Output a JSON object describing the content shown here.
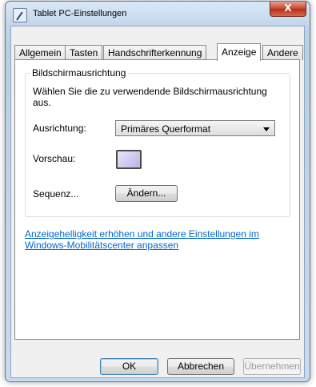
{
  "window": {
    "title": "Tablet PC-Einstellungen",
    "close_label": "X"
  },
  "tabs": [
    {
      "label": "Allgemein",
      "active": false
    },
    {
      "label": "Tasten",
      "active": false
    },
    {
      "label": "Handschrifterkennung",
      "active": false
    },
    {
      "label": "Anzeige",
      "active": true
    },
    {
      "label": "Andere",
      "active": false
    }
  ],
  "group": {
    "title": "Bildschirmausrichtung",
    "description": "Wählen Sie die zu verwendende Bildschirmausrichtung aus.",
    "orientation_label": "Ausrichtung:",
    "orientation_value": "Primäres Querformat",
    "preview_label": "Vorschau:",
    "sequence_label": "Sequenz...",
    "change_button": "Ändern..."
  },
  "link_text": "Anzeigehelligkeit erhöhen und andere Einstellungen im Windows-Mobilitätscenter anpassen",
  "footer": {
    "ok": "OK",
    "cancel": "Abbrechen",
    "apply": "Übernehmen"
  },
  "colors": {
    "link": "#0066cc",
    "close_button": "#c6462f"
  }
}
